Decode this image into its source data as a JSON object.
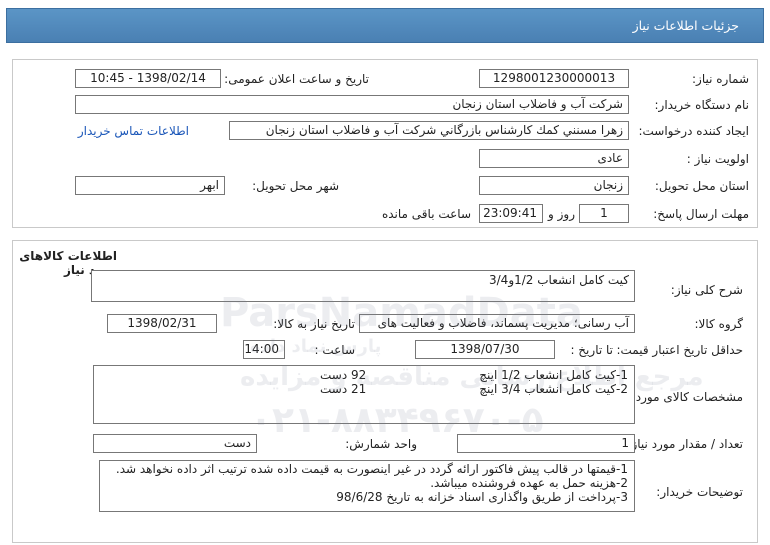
{
  "header": {
    "title": "جزئیات اطلاعات نیاز"
  },
  "watermark": {
    "brand": "ParsNamadData",
    "brand_fa": "پارس نماد داده",
    "tagline": "مرجع اطلاع رسانی مناقصه و مزایده",
    "phone": "۰۲۱-۸۸۳۴۹۶۷۰-۵"
  },
  "info": {
    "need_number_label": "شماره نیاز:",
    "need_number": "1298001230000013",
    "announce_label": "تاریخ و ساعت اعلان عمومی:",
    "announce_value": "1398/02/14 - 10:45",
    "buyer_label": "نام دستگاه خریدار:",
    "buyer_value": "شرکت آب و فاضلاب استان زنجان",
    "creator_label": "ایجاد کننده درخواست:",
    "creator_value": "زهرا مسنني كمك كارشناس بازرگاني شركت آب و فاضلاب استان زنجان",
    "contact_link": "اطلاعات تماس خریدار",
    "priority_label": "اولویت نیاز :",
    "priority_value": "عادی",
    "province_label": "استان محل تحویل:",
    "province_value": "زنجان",
    "city_label": "شهر محل تحویل:",
    "city_value": "ابهر",
    "deadline_label": "مهلت ارسال پاسخ:",
    "deadline_days": "1",
    "days_word": "روز و",
    "deadline_time": "23:09:41",
    "remaining_word": "ساعت باقی مانده"
  },
  "goods": {
    "section_title": "اطلاعات کالاهای مورد نیاز",
    "general_label": "شرح کلی نیاز:",
    "general_value": "کیت کامل انشعاب 1/2و3/4",
    "group_label": "گروه کالا:",
    "group_value": "آب رسانی؛ مدیریت پسماند، فاضلاب و فعالیت های",
    "need_date_label": "تاریخ نیاز به کالا:",
    "need_date_value": "1398/02/31",
    "validity_label": "حداقل تاریخ اعتبار قیمت:",
    "until_label": "تا تاریخ :",
    "validity_date": "1398/07/30",
    "time_label": "ساعت :",
    "validity_time": "14:00",
    "spec_label": "مشخصات کالای مورد نیاز:",
    "spec_lines": [
      {
        "text": "1-کیت کامل انشعاب 1/2 اینچ",
        "qty": "92 دست"
      },
      {
        "text": "2-کیت کامل انشعاب 3/4 اینچ",
        "qty": "21 دست"
      }
    ],
    "count_label": "تعداد / مقدار مورد نیاز:",
    "count_value": "1",
    "unit_label": "واحد شمارش:",
    "unit_value": "دست",
    "notes_label": "توضیحات خریدار:",
    "notes_lines": [
      "1-قیمتها در قالب پیش فاکتور ارائه گردد در غیر اینصورت به قیمت داده شده ترتیب اثر داده نخواهد شد.",
      "2-هزینه حمل به عهده فروشنده میباشد.",
      "3-پرداخت از طریق واگذاری اسناد خزانه به تاریخ 98/6/28"
    ]
  }
}
